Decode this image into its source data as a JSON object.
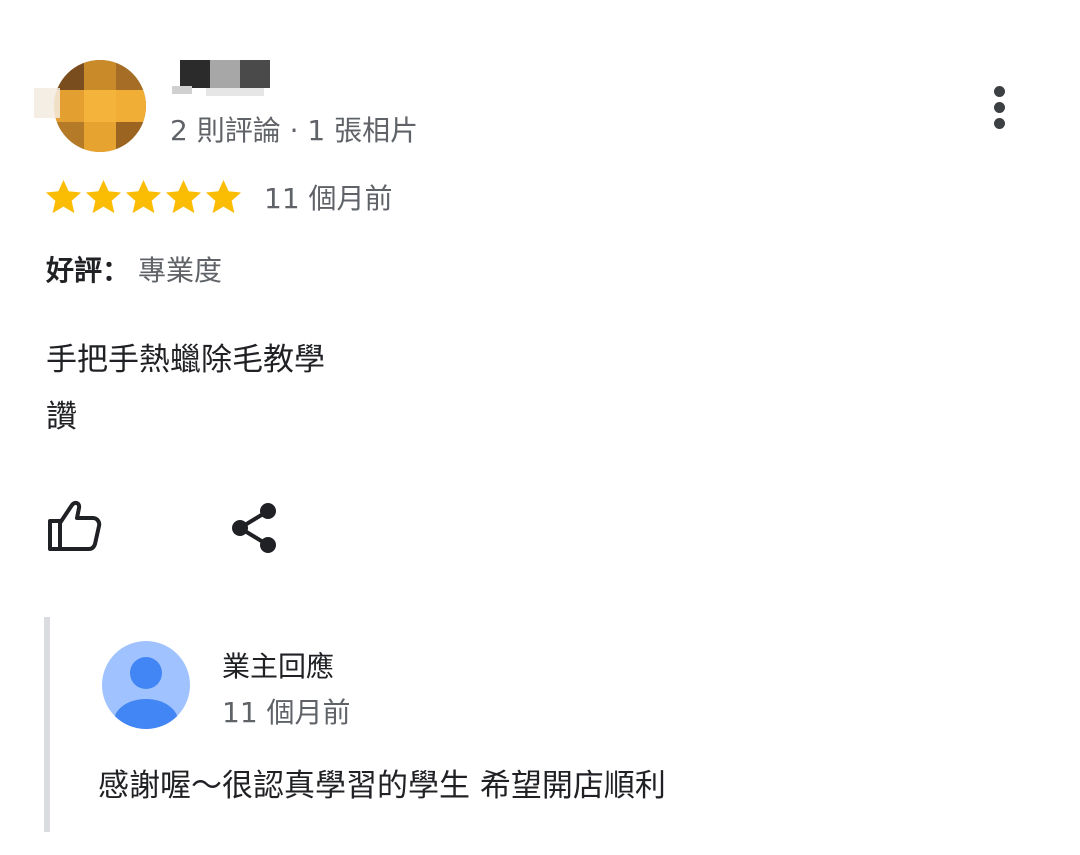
{
  "review": {
    "reviewer": {
      "name": "",
      "stats": "2 則評論 · 1 張相片"
    },
    "rating": 5,
    "rating_max": 5,
    "time": "11 個月前",
    "highlight": {
      "label": "好評：",
      "value": "專業度"
    },
    "text_lines": [
      "手把手熱蠟除毛教學",
      "讚"
    ],
    "actions": {
      "like_icon": "thumb-up-icon",
      "share_icon": "share-icon",
      "more_icon": "more-vert-icon"
    }
  },
  "owner_reply": {
    "title": "業主回應",
    "time": "11 個月前",
    "text": "感謝喔～很認真學習的學生 希望開店順利",
    "avatar_icon": "person-icon"
  },
  "colors": {
    "star": "#FBBC04",
    "secondary_text": "#5f6368",
    "primary_text": "#202124",
    "reply_border": "#dadce0",
    "owner_avatar_bg": "#a0c3ff",
    "owner_avatar_fg": "#4285f4"
  }
}
